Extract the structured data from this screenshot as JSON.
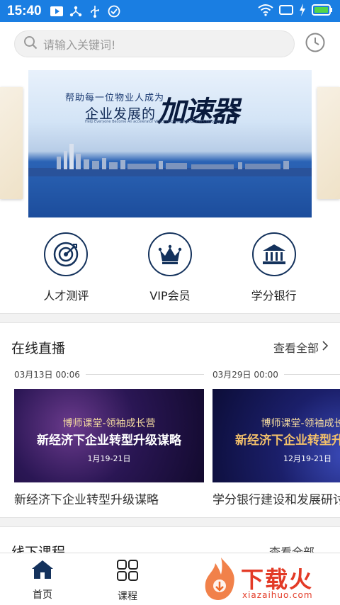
{
  "status_bar": {
    "time": "15:40"
  },
  "search": {
    "placeholder": "请输入关键词!"
  },
  "banner": {
    "headline_small": "帮助每一位物业人成为",
    "headline_main": "企业发展的",
    "brush_text": "加速器",
    "english": "Help Everyone Become An accelerator Which Improves His Or Her Company"
  },
  "quick_entries": [
    {
      "label": "人才测评",
      "icon": "radar-target-icon"
    },
    {
      "label": "VIP会员",
      "icon": "crown-icon"
    },
    {
      "label": "学分银行",
      "icon": "bank-icon"
    }
  ],
  "live": {
    "title": "在线直播",
    "more": "查看全部",
    "items": [
      {
        "date": "03月13日 00:06",
        "thumb_line1": "博师课堂-领袖成长营",
        "thumb_line2": "新经济下企业转型升级谋略",
        "thumb_line3": "1月19-21日",
        "title": "新经济下企业转型升级谋略"
      },
      {
        "date": "03月29日 00:00",
        "thumb_line1": "博师课堂-领袖成长营",
        "thumb_line2": "新经济下企业转型升级谋略",
        "thumb_line3": "12月19-21日",
        "title": "学分银行建设和发展研讨"
      }
    ]
  },
  "offline": {
    "title": "线下课程",
    "more": "查看全部"
  },
  "bottom_nav": [
    {
      "label": "首页",
      "icon": "home-icon",
      "active": true
    },
    {
      "label": "课程",
      "icon": "grid-icon",
      "active": false
    }
  ],
  "watermark": {
    "text": "下载火",
    "sub": "xiazaihuo.com"
  },
  "colors": {
    "status_bar": "#1a7ee2",
    "accent_dark": "#14325c",
    "watermark": "#e33a26"
  }
}
